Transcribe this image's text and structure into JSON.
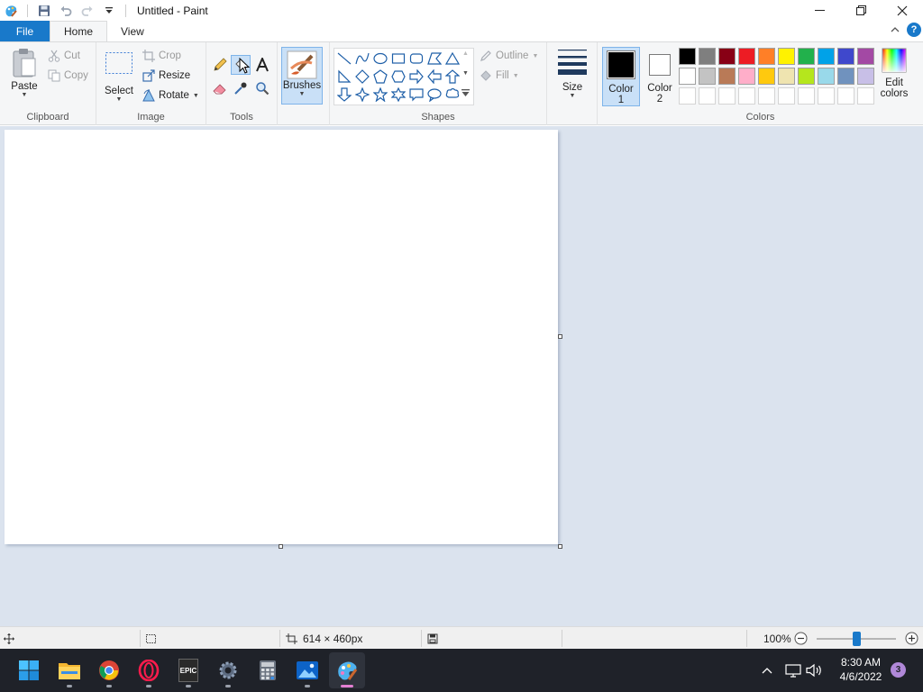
{
  "window": {
    "title": "Untitled - Paint"
  },
  "tabs": {
    "file": "File",
    "home": "Home",
    "view": "View"
  },
  "clipboard": {
    "paste": "Paste",
    "cut": "Cut",
    "copy": "Copy",
    "label": "Clipboard"
  },
  "image": {
    "select": "Select",
    "crop": "Crop",
    "resize": "Resize",
    "rotate": "Rotate",
    "label": "Image"
  },
  "tools": {
    "label": "Tools"
  },
  "brushes": {
    "label": "Brushes"
  },
  "shapes": {
    "outline": "Outline",
    "fill": "Fill",
    "label": "Shapes"
  },
  "size": {
    "label": "Size"
  },
  "colors": {
    "color1": "Color",
    "color1_num": "1",
    "color2": "Color",
    "color2_num": "2",
    "edit": "Edit",
    "edit2": "colors",
    "label": "Colors",
    "color1_value": "#000000",
    "color2_value": "#ffffff",
    "palette_row1": [
      "#000000",
      "#7f7f7f",
      "#880015",
      "#ed1c24",
      "#ff7f27",
      "#fff200",
      "#22b14c",
      "#00a2e8",
      "#3f48cc",
      "#a349a4"
    ],
    "palette_row2": [
      "#ffffff",
      "#c3c3c3",
      "#b97a57",
      "#ffaec9",
      "#ffc90e",
      "#efe4b0",
      "#b5e61d",
      "#99d9ea",
      "#7092be",
      "#c8bfe7"
    ]
  },
  "status": {
    "canvas_size": "614 × 460px",
    "zoom": "100%",
    "zoom_level": 0.5
  },
  "taskbar": {
    "apps": [
      "start-icon",
      "file-explorer-icon",
      "chrome-icon",
      "opera-gx-icon",
      "epic-games-icon",
      "settings-icon",
      "calculator-icon",
      "photos-icon",
      "paint-icon"
    ],
    "epic_logo": "EPIC",
    "time": "8:30 AM",
    "date": "4/6/2022",
    "notifications": "3"
  }
}
